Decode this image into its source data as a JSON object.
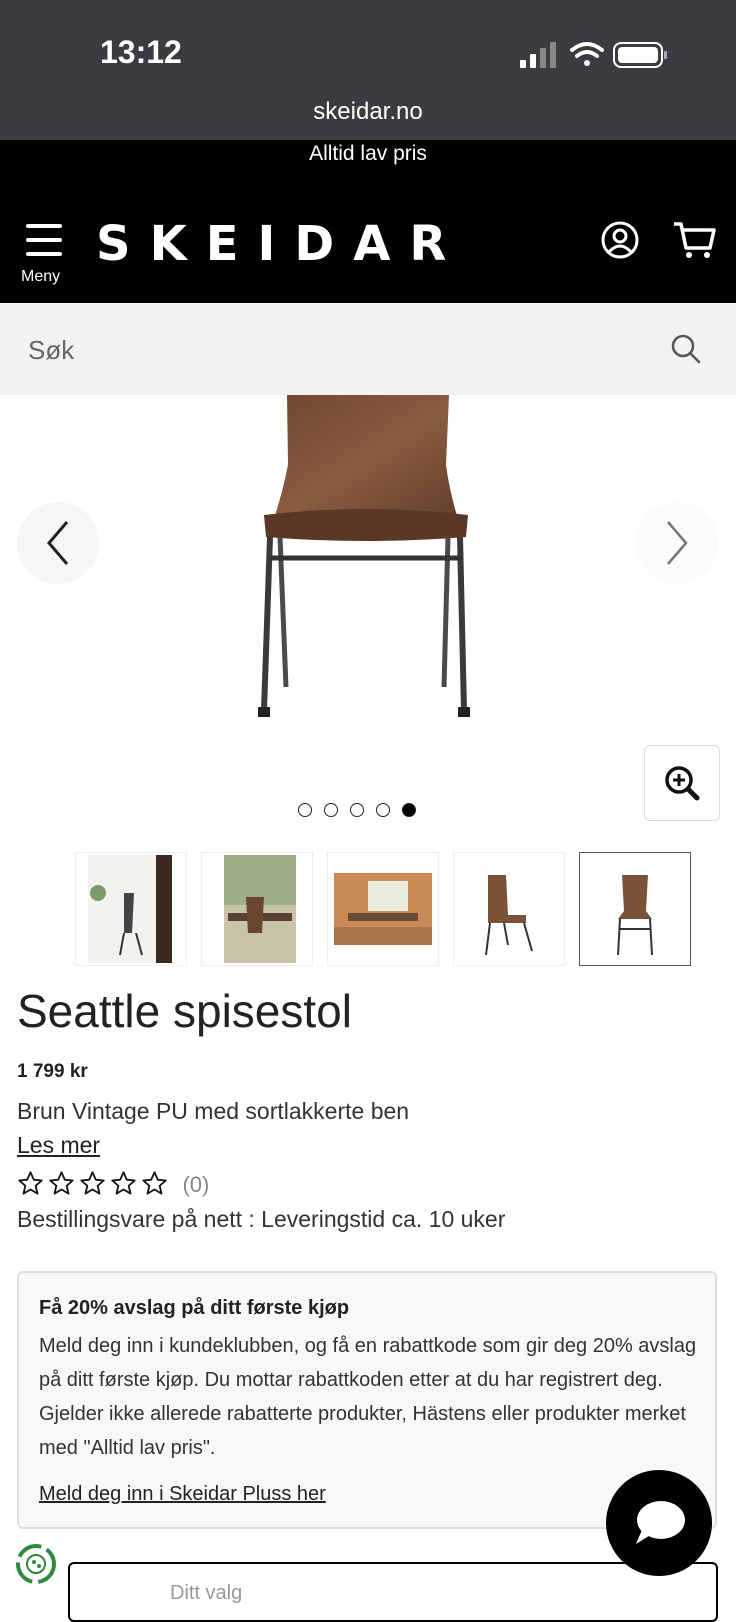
{
  "status_bar": {
    "time": "13:12",
    "url": "skeidar.no"
  },
  "promo": {
    "text": "Alltid lav pris"
  },
  "header": {
    "menu_label": "Meny",
    "logo": "SKEIDAR"
  },
  "search": {
    "placeholder": "Søk"
  },
  "gallery": {
    "image_count": 5,
    "active_index": 4
  },
  "product": {
    "title": "Seattle spisestol",
    "price": "1 799 kr",
    "variant": "Brun Vintage PU med sortlakkerte ben",
    "read_more": "Les mer",
    "rating_stars": 5,
    "rating_count": "(0)",
    "delivery": "Bestillingsvare på nett : Leveringstid ca. 10 uker"
  },
  "club": {
    "title": "Få 20% avslag på ditt første kjøp",
    "text": "Meld deg inn i kundeklubben, og få en rabattkode som gir deg 20% avslag på ditt første kjøp. Du mottar rabattkoden etter at du har registrert deg. Gjelder ikke allerede rabatterte produkter, Hästens eller produkter merket med \"Alltid lav pris\".",
    "link": "Meld deg inn i Skeidar Pluss her"
  },
  "bottom": {
    "label": "Ditt valg"
  },
  "colors": {
    "header_bg": "#000000",
    "status_bg": "#3a3c3f",
    "search_bg": "#f2f2f2",
    "chair_brown": "#7a5237"
  }
}
